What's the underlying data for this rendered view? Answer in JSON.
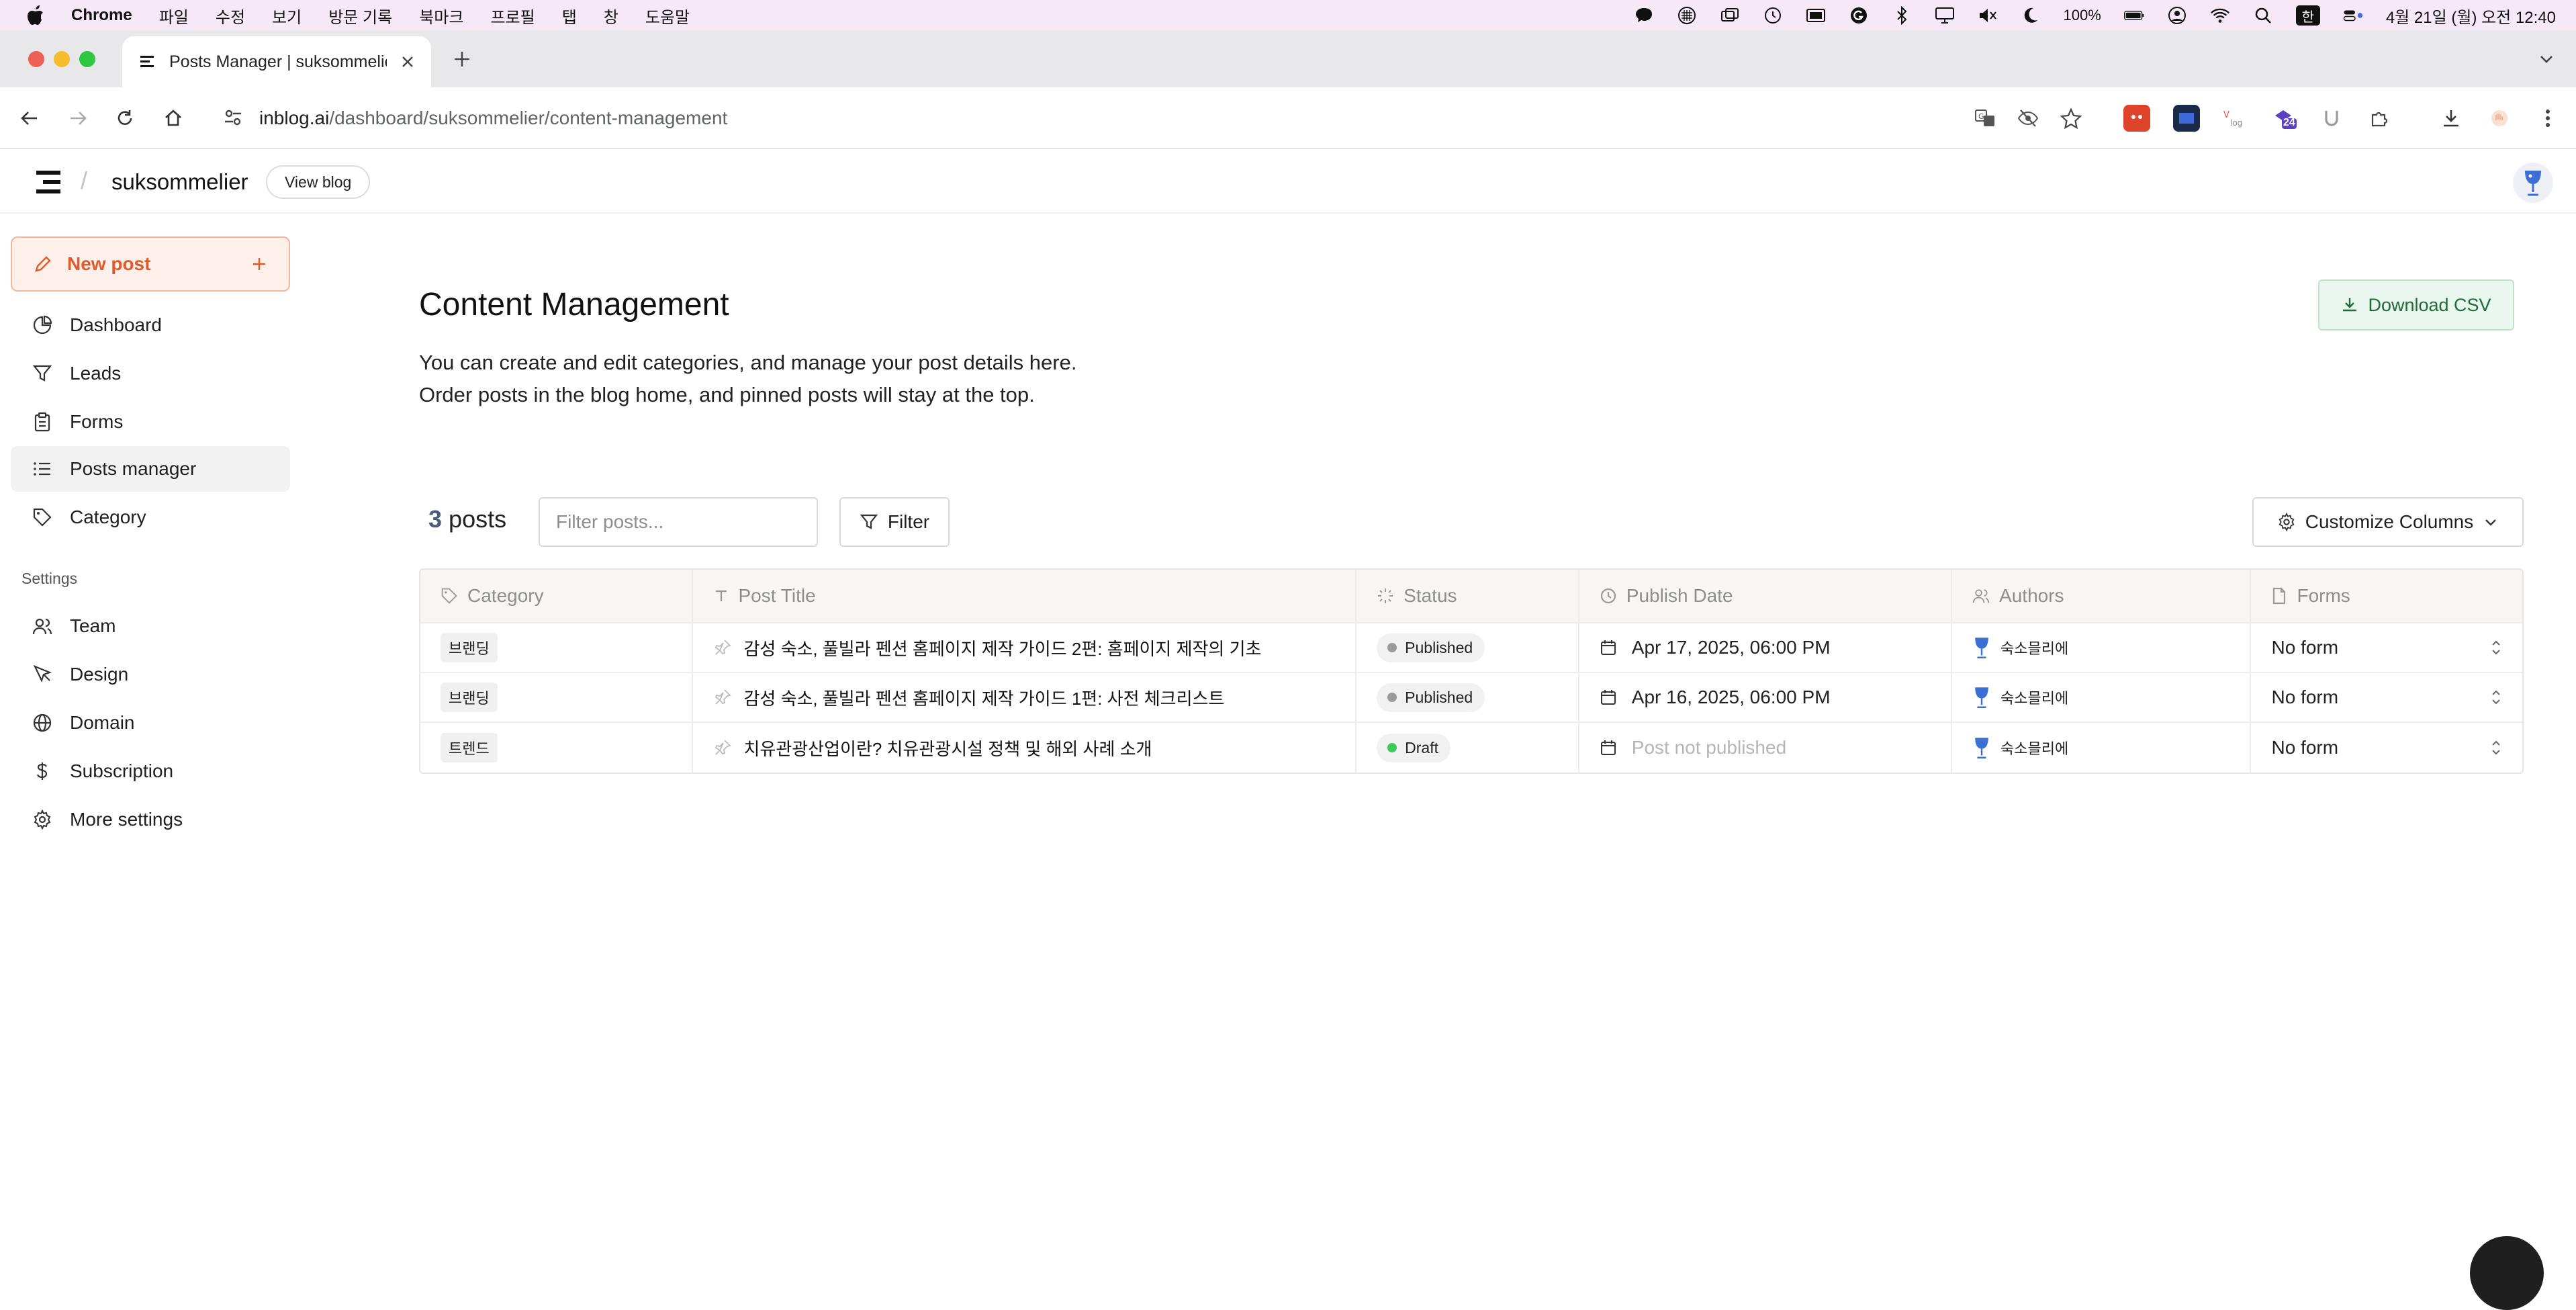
{
  "menubar": {
    "app": "Chrome",
    "items": [
      "파일",
      "수정",
      "보기",
      "방문 기록",
      "북마크",
      "프로필",
      "탭",
      "창",
      "도움말"
    ],
    "battery": "100%",
    "input_method": "한",
    "clock": "4월 21일 (월) 오전 12:40"
  },
  "browser": {
    "tab_title": "Posts Manager | suksommelier",
    "url_host": "inblog.ai",
    "url_path": "/dashboard/suksommelier/content-management",
    "extension_badge": "24"
  },
  "header": {
    "blog_name": "suksommelier",
    "view_blog": "View blog"
  },
  "sidebar": {
    "new_post": "New post",
    "items": [
      {
        "label": "Dashboard",
        "icon": "pie-chart-icon"
      },
      {
        "label": "Leads",
        "icon": "funnel-icon"
      },
      {
        "label": "Forms",
        "icon": "clipboard-icon"
      },
      {
        "label": "Posts manager",
        "icon": "list-icon"
      },
      {
        "label": "Category",
        "icon": "tag-icon"
      }
    ],
    "settings_heading": "Settings",
    "settings_items": [
      {
        "label": "Team",
        "icon": "users-icon"
      },
      {
        "label": "Design",
        "icon": "cursor-icon"
      },
      {
        "label": "Domain",
        "icon": "globe-icon"
      },
      {
        "label": "Subscription",
        "icon": "dollar-icon"
      },
      {
        "label": "More settings",
        "icon": "gear-icon"
      }
    ]
  },
  "main": {
    "title": "Content Management",
    "description_line1": "You can create and edit categories, and manage your post details here.",
    "description_line2": "Order posts in the blog home, and pinned posts will stay at the top.",
    "download_csv": "Download CSV",
    "post_count": "3",
    "post_count_label": "posts",
    "filter_placeholder": "Filter posts...",
    "filter_button": "Filter",
    "customize_columns": "Customize Columns"
  },
  "table": {
    "columns": [
      "Category",
      "Post Title",
      "Status",
      "Publish Date",
      "Authors",
      "Forms"
    ],
    "rows": [
      {
        "category": "브랜딩",
        "title": "감성 숙소, 풀빌라 펜션 홈페이지 제작 가이드 2편: 홈페이지 제작의 기초",
        "status": "Published",
        "status_color": "#9a9a9a",
        "date": "Apr 17, 2025, 06:00 PM",
        "date_muted": false,
        "author": "숙소믈리에",
        "form": "No form"
      },
      {
        "category": "브랜딩",
        "title": "감성 숙소, 풀빌라 펜션 홈페이지 제작 가이드 1편: 사전 체크리스트",
        "status": "Published",
        "status_color": "#9a9a9a",
        "date": "Apr 16, 2025, 06:00 PM",
        "date_muted": false,
        "author": "숙소믈리에",
        "form": "No form"
      },
      {
        "category": "트렌드",
        "title": "치유관광산업이란? 치유관광시설 정책 및 해외 사례 소개",
        "status": "Draft",
        "status_color": "#3ccb5a",
        "date": "Post not published",
        "date_muted": true,
        "author": "숙소믈리에",
        "form": "No form"
      }
    ]
  },
  "colors": {
    "accent": "#e05a2a",
    "csv_green": "#1e6a3a",
    "menubar": "#f6e8f7"
  }
}
